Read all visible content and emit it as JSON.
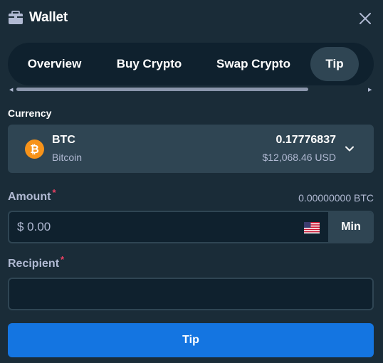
{
  "header": {
    "title": "Wallet",
    "icon": "wallet-icon",
    "close_icon": "close-icon"
  },
  "tabs": [
    {
      "label": "Overview",
      "active": false
    },
    {
      "label": "Buy Crypto",
      "active": false
    },
    {
      "label": "Swap Crypto",
      "active": false
    },
    {
      "label": "Tip",
      "active": true
    }
  ],
  "currency": {
    "label": "Currency",
    "code": "BTC",
    "name": "Bitcoin",
    "balance": "0.17776837",
    "balance_usd": "$12,068.46 USD",
    "icon": "bitcoin-icon"
  },
  "amount": {
    "label": "Amount",
    "required_mark": "*",
    "crypto_equivalent": "0.00000000 BTC",
    "placeholder": "$ 0.00",
    "flag_icon": "us-flag-icon",
    "min_label": "Min"
  },
  "recipient": {
    "label": "Recipient",
    "required_mark": "*",
    "value": ""
  },
  "submit_label": "Tip",
  "colors": {
    "background": "#1a2c38",
    "panel": "#2f4553",
    "input": "#0f212e",
    "accent": "#1475e1",
    "muted_text": "#b1bad3",
    "required": "#ed4163",
    "bitcoin": "#f7931a"
  }
}
